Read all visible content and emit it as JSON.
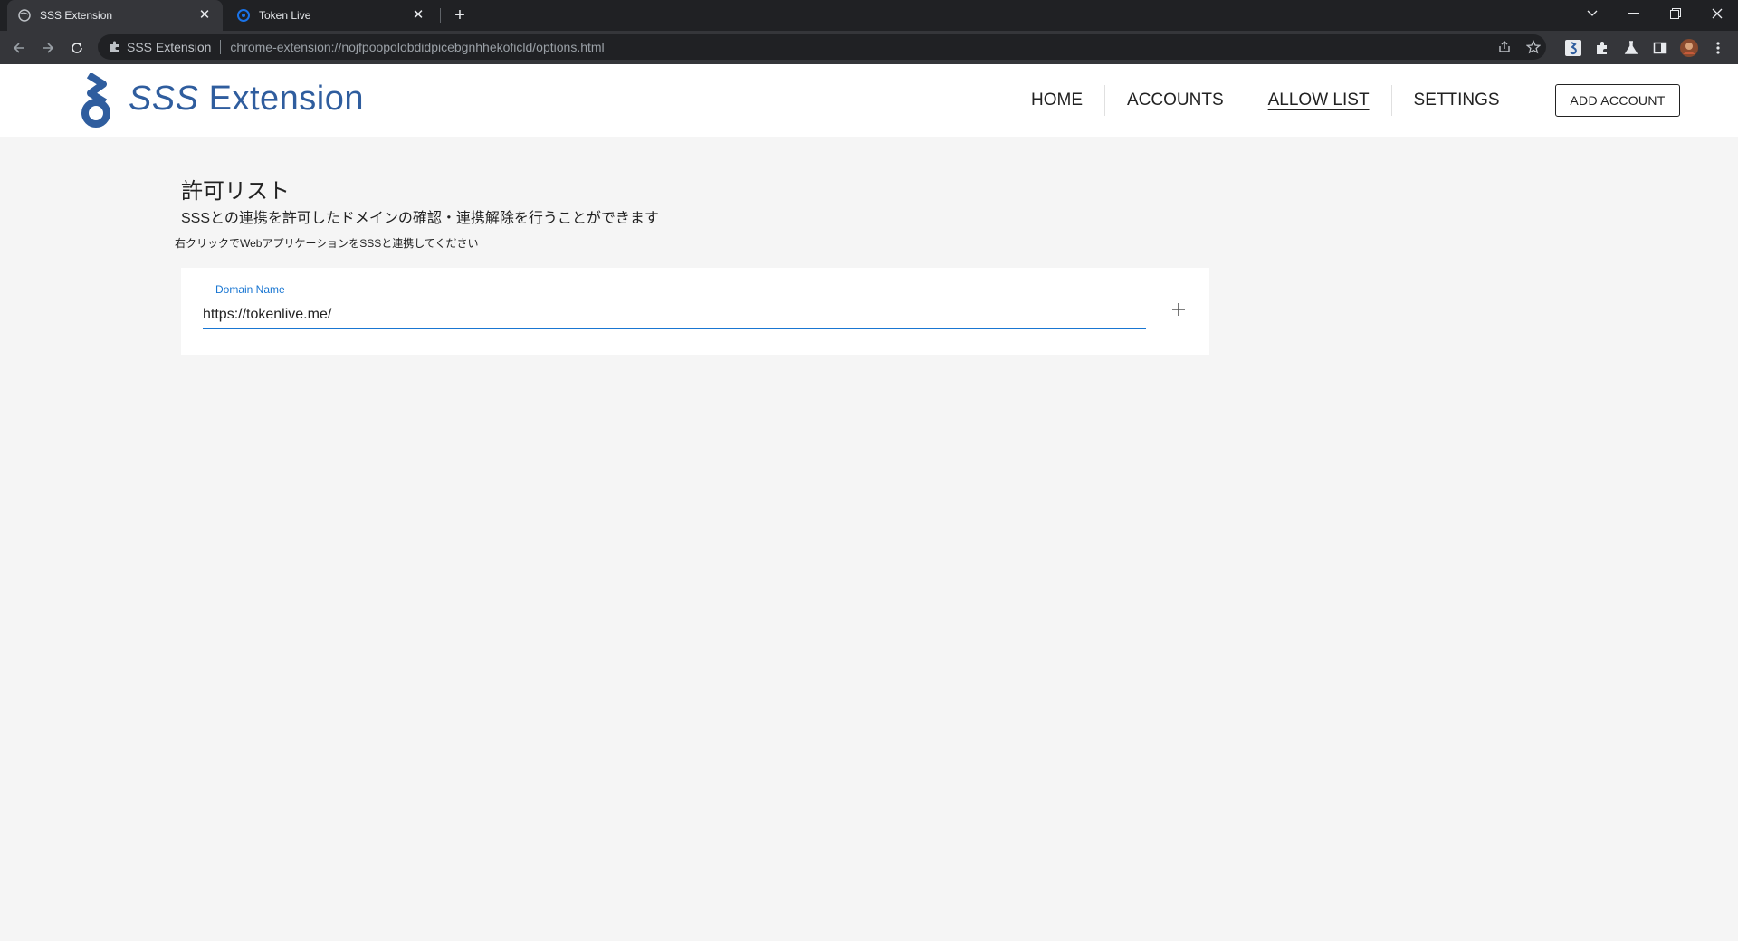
{
  "browser": {
    "tabs": [
      {
        "title": "SSS Extension",
        "active": true
      },
      {
        "title": "Token Live",
        "active": false
      }
    ],
    "omnibox": {
      "ext_name": "SSS Extension",
      "url": "chrome-extension://nojfpoopolobdidpicebgnhhekoficld/options.html"
    }
  },
  "header": {
    "brand": "SSS",
    "brand_suffix": "Extension",
    "nav": [
      "HOME",
      "ACCOUNTS",
      "ALLOW LIST",
      "SETTINGS"
    ],
    "active_nav": "ALLOW LIST",
    "add_account": "ADD ACCOUNT"
  },
  "main": {
    "title": "許可リスト",
    "subtitle": "SSSとの連携を許可したドメインの確認・連携解除を行うことができます",
    "hint": "右クリックでWebアプリケーションをSSSと連携してください",
    "domain_field": {
      "label": "Domain Name",
      "value": "https://tokenlive.me/"
    }
  },
  "colors": {
    "brand": "#2f5d9e",
    "accent": "#1976d2",
    "page_bg": "#f5f5f5"
  }
}
